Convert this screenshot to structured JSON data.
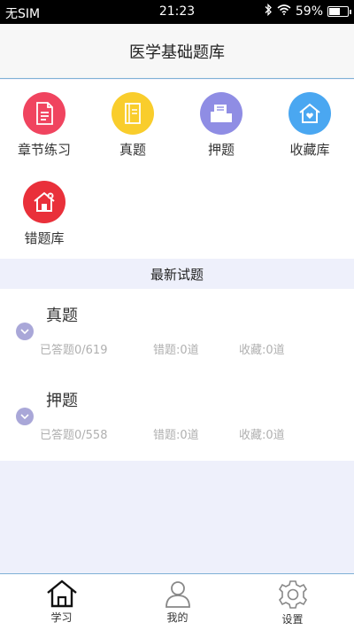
{
  "status": {
    "carrier": "无SIM",
    "time": "21:23",
    "battery": "59%",
    "battery_level": 0.59
  },
  "header": {
    "title": "医学基础题库"
  },
  "menu": [
    {
      "label": "章节练习",
      "icon": "document-icon",
      "color": "#f0445f"
    },
    {
      "label": "真题",
      "icon": "book-icon",
      "color": "#f9cd2c"
    },
    {
      "label": "押题",
      "icon": "folder-icon",
      "color": "#8f8de4"
    },
    {
      "label": "收藏库",
      "icon": "home-heart-icon",
      "color": "#4aa7f1"
    },
    {
      "label": "错题库",
      "icon": "home-x-icon",
      "color": "#e9303a"
    }
  ],
  "section": {
    "title": "最新试题"
  },
  "exams": [
    {
      "title": "真题",
      "answered": "已答题0/619",
      "wrong": "错题:0道",
      "favorites": "收藏:0道"
    },
    {
      "title": "押题",
      "answered": "已答题0/558",
      "wrong": "错题:0道",
      "favorites": "收藏:0道"
    }
  ],
  "tabs": [
    {
      "label": "学习",
      "icon": "home-icon",
      "active": true
    },
    {
      "label": "我的",
      "icon": "user-icon",
      "active": false
    },
    {
      "label": "设置",
      "icon": "gear-icon",
      "active": false
    }
  ]
}
